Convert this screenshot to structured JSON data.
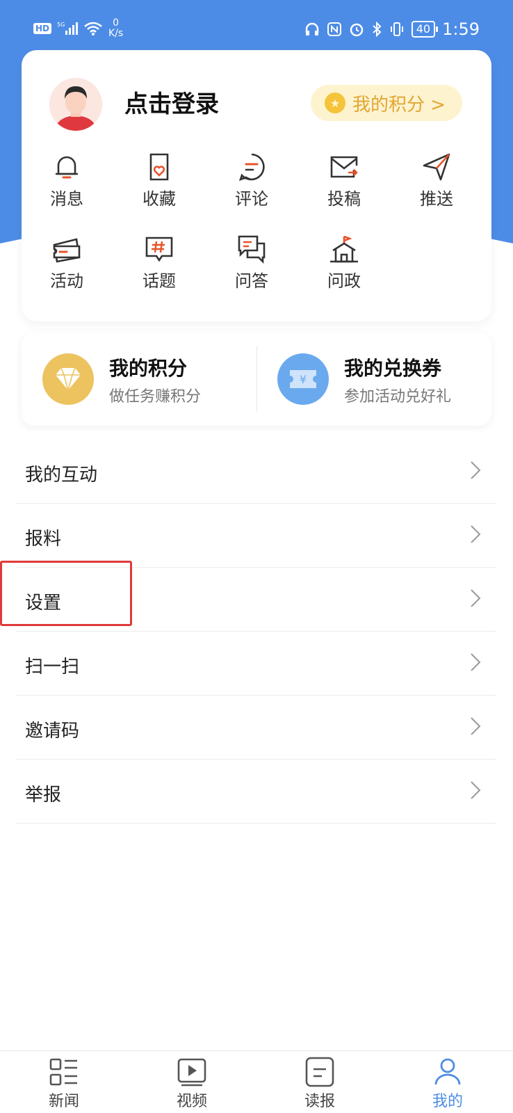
{
  "status_bar": {
    "hd": "HD",
    "speed_value": "0",
    "speed_unit": "K/s",
    "battery": "40",
    "time": "1:59"
  },
  "profile": {
    "login_text": "点击登录",
    "points_pill": "我的积分 >"
  },
  "grid": [
    {
      "label": "消息",
      "icon": "bell-icon"
    },
    {
      "label": "收藏",
      "icon": "favorite-icon"
    },
    {
      "label": "评论",
      "icon": "comment-icon"
    },
    {
      "label": "投稿",
      "icon": "submit-mail-icon"
    },
    {
      "label": "推送",
      "icon": "push-send-icon"
    },
    {
      "label": "活动",
      "icon": "ticket-icon"
    },
    {
      "label": "话题",
      "icon": "topic-hash-icon"
    },
    {
      "label": "问答",
      "icon": "qa-chat-icon"
    },
    {
      "label": "问政",
      "icon": "government-building-icon"
    }
  ],
  "points_card": {
    "points": {
      "title": "我的积分",
      "subtitle": "做任务赚积分"
    },
    "coupons": {
      "title": "我的兑换券",
      "subtitle": "参加活动兑好礼"
    }
  },
  "menu": [
    {
      "label": "我的互动"
    },
    {
      "label": "报料"
    },
    {
      "label": "设置"
    },
    {
      "label": "扫一扫"
    },
    {
      "label": "邀请码"
    },
    {
      "label": "举报"
    }
  ],
  "bottom_nav": [
    {
      "label": "新闻",
      "icon": "news-grid-icon"
    },
    {
      "label": "视频",
      "icon": "video-play-icon"
    },
    {
      "label": "读报",
      "icon": "newspaper-icon"
    },
    {
      "label": "我的",
      "icon": "profile-icon",
      "active": true
    }
  ],
  "colors": {
    "brand_blue": "#4d8ce6",
    "accent_orange": "#e8532a",
    "gold": "#f5c43a",
    "highlight_red": "#e03a3a"
  }
}
